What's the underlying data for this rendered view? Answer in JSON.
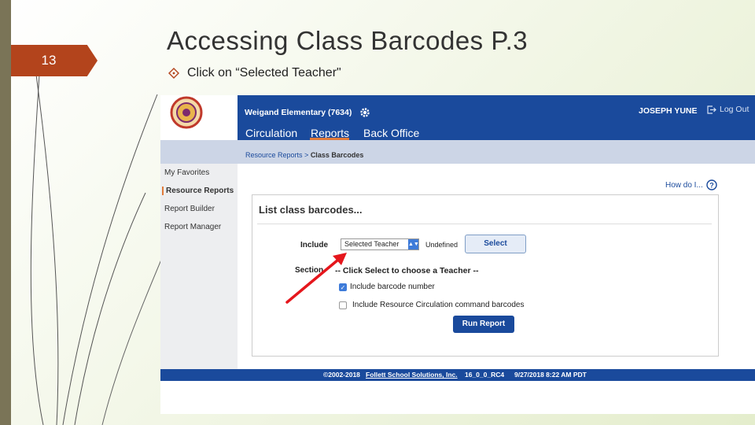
{
  "slide": {
    "number": "13",
    "title": "Accessing Class Barcodes P.3",
    "bullet": "Click on “Selected Teacher\"",
    "colors": {
      "accent_tab": "#b3441c",
      "left_bar": "#7a7457"
    }
  },
  "app": {
    "school": "Weigand Elementary (7634)",
    "nav": [
      "Circulation",
      "Reports",
      "Back Office"
    ],
    "active_nav": "Reports",
    "user": "JOSEPH YUNE",
    "logout": "Log Out",
    "breadcrumb": {
      "parent": "Resource Reports",
      "separator": " > ",
      "current": "Class Barcodes"
    },
    "sidebar": [
      "My Favorites",
      "Resource Reports",
      "Report Builder",
      "Report Manager"
    ],
    "active_sidebar": "Resource Reports",
    "help_link": "How do I...",
    "panel": {
      "title": "List class barcodes...",
      "include_label": "Include",
      "include_select_value": "Selected Teacher",
      "undefined_text": "Undefined",
      "select_button": "Select",
      "section_label": "Section",
      "section_text": "-- Click Select to choose a Teacher --",
      "checkbox1": {
        "label": "Include barcode number",
        "checked": true
      },
      "checkbox2": {
        "label": "Include Resource Circulation command barcodes",
        "checked": false
      },
      "run_button": "Run Report"
    },
    "footer": {
      "copyright": "©2002-2018",
      "company": "Follett School Solutions, Inc.",
      "version": "16_0_0_RC4",
      "datetime": "9/27/2018 8:22 AM PDT"
    },
    "colors": {
      "header": "#1a4a9c",
      "accent": "#e07a3a",
      "annotation_arrow": "#e5161c"
    }
  }
}
